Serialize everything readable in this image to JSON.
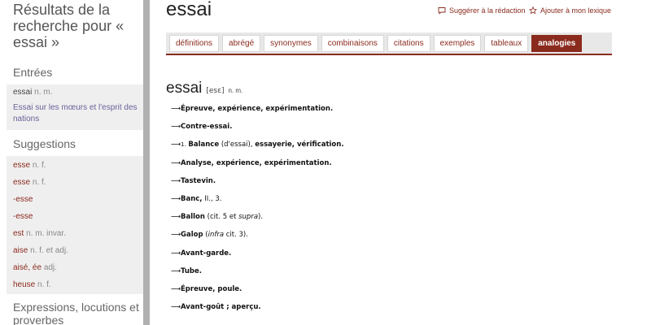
{
  "sidebar": {
    "title": "Résultats de la recherche pour « essai »",
    "entries_heading": "Entrées",
    "entries": [
      {
        "word": "essai",
        "gram": "n. m."
      },
      {
        "word": "Essai sur les mœurs et l'esprit des nations",
        "gram": ""
      }
    ],
    "suggestions_heading": "Suggestions",
    "suggestions": [
      {
        "word": "esse",
        "gram": "n. f."
      },
      {
        "word": "esse",
        "gram": "n. f."
      },
      {
        "word": "-esse",
        "gram": ""
      },
      {
        "word": "-esse",
        "gram": ""
      },
      {
        "word": "est",
        "gram": "n. m. invar."
      },
      {
        "word": "aise",
        "gram": "n. f. et adj."
      },
      {
        "word": "aisé, ée",
        "gram": "adj."
      },
      {
        "word": "heuse",
        "gram": "n. f."
      }
    ],
    "expressions_heading": "Expressions, locutions et proverbes"
  },
  "main": {
    "headword": "essai",
    "actions": {
      "suggest": "Suggérer à la rédaction",
      "add_lexicon": "Ajouter à mon lexique"
    },
    "tabs": [
      "définitions",
      "abrégé",
      "synonymes",
      "combinaisons",
      "citations",
      "exemples",
      "tableaux",
      "analogies"
    ],
    "active_tab": "analogies",
    "entry": {
      "word": "essai",
      "phonetic": "[esɛ]",
      "gram": "n. m."
    },
    "arrow": "⟶",
    "analogies": [
      {
        "text": "Épreuve, expérience, expérimentation."
      },
      {
        "text": "Contre-essai."
      },
      {
        "pre": "1.",
        "text": "Balance",
        "note": "(d'essai),",
        "rest": "essayerie, vérification."
      },
      {
        "text": "Analyse, expérience, expérimentation."
      },
      {
        "text": "Tastevin."
      },
      {
        "text": "Banc,",
        "note": "II., 3."
      },
      {
        "text": "Ballon",
        "note": "(cit. 5 et",
        "ital": "supra",
        "note2": ")."
      },
      {
        "text": "Galop",
        "note": "(",
        "ital": "infra",
        "note2": "cit. 3)."
      },
      {
        "text": "Avant-garde."
      },
      {
        "text": "Tube."
      },
      {
        "text": "Épreuve, poule."
      },
      {
        "text": "Avant-goût ; aperçu."
      }
    ]
  }
}
